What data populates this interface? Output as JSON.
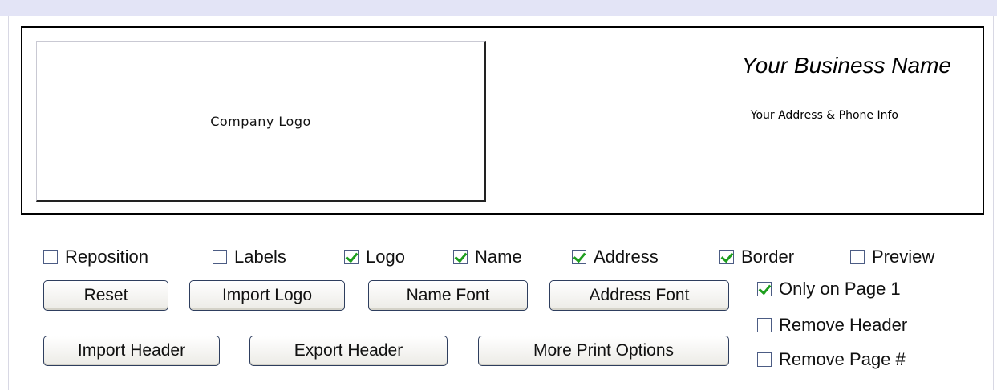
{
  "header_preview": {
    "logo_label": "Company Logo",
    "business_name": "Your Business Name",
    "address_info": "Your Address & Phone Info"
  },
  "options_row": [
    {
      "label": "Reposition",
      "checked": false
    },
    {
      "label": "Labels",
      "checked": false
    },
    {
      "label": "Logo",
      "checked": true
    },
    {
      "label": "Name",
      "checked": true
    },
    {
      "label": "Address",
      "checked": true
    },
    {
      "label": "Border",
      "checked": true
    },
    {
      "label": "Preview",
      "checked": false
    }
  ],
  "buttons": {
    "reset": "Reset",
    "import_logo": "Import Logo",
    "name_font": "Name Font",
    "address_font": "Address Font",
    "import_header": "Import Header",
    "export_header": "Export Header",
    "more_print_options": "More Print Options"
  },
  "page_options": [
    {
      "label": "Only on Page 1",
      "checked": true
    },
    {
      "label": "Remove Header",
      "checked": false
    },
    {
      "label": "Remove Page #",
      "checked": false
    }
  ],
  "colors": {
    "check_mark": "#1d9e1d",
    "top_strip": "#e3e4f6",
    "button_border": "#2e3e5e"
  }
}
